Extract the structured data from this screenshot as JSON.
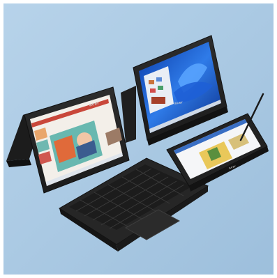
{
  "scene": {
    "background_color": "#a9c9e3",
    "device_body_color": "#232323",
    "device_edge_color": "#141414",
    "brand_wordmark": "acer",
    "devices": [
      {
        "mode": "laptop",
        "screen_content": "presentation-slide"
      },
      {
        "mode": "tablet-stand",
        "screen_content": "windows-11-start"
      },
      {
        "mode": "tent",
        "screen_content": "hidden"
      },
      {
        "mode": "flat-tablet",
        "screen_content": "document-with-pen"
      }
    ],
    "accessories": [
      "stylus-pen"
    ]
  }
}
